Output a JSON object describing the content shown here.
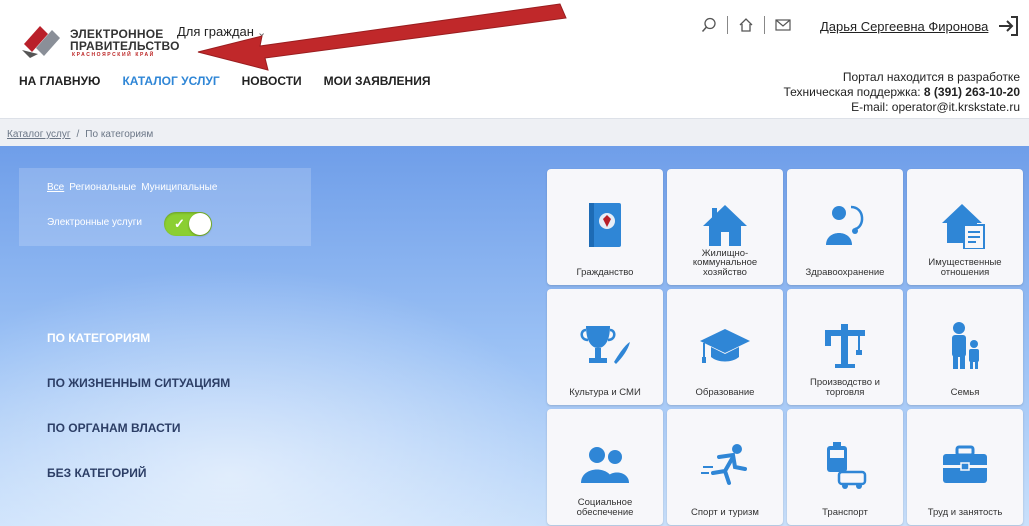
{
  "header": {
    "logo": {
      "line1": "ЭЛЕКТРОННОЕ",
      "line2": "ПРАВИТЕЛЬСТВО",
      "line3": "КРАСНОЯРСКИЙ КРАЙ"
    },
    "audience_label": "Для граждан",
    "icons": [
      "search-icon",
      "home-icon",
      "mail-icon"
    ],
    "user_name": "Дарья Сергеевна Фиронова",
    "nav": [
      {
        "label": "НА ГЛАВНУЮ"
      },
      {
        "label": "КАТАЛОГ УСЛУГ"
      },
      {
        "label": "НОВОСТИ"
      },
      {
        "label": "МОИ ЗАЯВЛЕНИЯ"
      }
    ],
    "support": {
      "line1": "Портал находится в разработке",
      "phone_label": "Техническая поддержка: ",
      "phone": "8 (391) 263-10-20",
      "email": "E-mail: operator@it.krskstate.ru"
    }
  },
  "breadcrumb": {
    "link": "Каталог услуг",
    "separator": "/",
    "current": "По категориям"
  },
  "filter": {
    "tabs": [
      {
        "label": "Все"
      },
      {
        "label": "Региональные"
      },
      {
        "label": "Муниципальные"
      }
    ],
    "toggle_label": "Электронные услуги",
    "toggle_on": true
  },
  "left_menu": [
    {
      "label": "ПО КАТЕГОРИЯМ"
    },
    {
      "label": "ПО ЖИЗНЕННЫМ СИТУАЦИЯМ"
    },
    {
      "label": "ПО ОРГАНАМ ВЛАСТИ"
    },
    {
      "label": "БЕЗ КАТЕГОРИЙ"
    }
  ],
  "categories": [
    {
      "label": "Гражданство",
      "icon": "passport-icon"
    },
    {
      "label": "Жилищно-коммунальное хозяйство",
      "icon": "house-icon"
    },
    {
      "label": "Здравоохранение",
      "icon": "doctor-icon"
    },
    {
      "label": "Имущественные отношения",
      "icon": "property-icon"
    },
    {
      "label": "Культура и СМИ",
      "icon": "trophy-icon"
    },
    {
      "label": "Образование",
      "icon": "graduation-cap-icon"
    },
    {
      "label": "Производство и торговля",
      "icon": "crane-icon"
    },
    {
      "label": "Семья",
      "icon": "family-icon"
    },
    {
      "label": "Социальное обеспечение",
      "icon": "people-icon"
    },
    {
      "label": "Спорт и туризм",
      "icon": "runner-icon"
    },
    {
      "label": "Транспорт",
      "icon": "transport-icon"
    },
    {
      "label": "Труд и занятость",
      "icon": "briefcase-icon"
    }
  ],
  "colors": {
    "accent": "#2f86d6",
    "toggle_on": "#8bcf32",
    "arrow": "#c0282a",
    "icon_blue": "#2f86d6"
  }
}
